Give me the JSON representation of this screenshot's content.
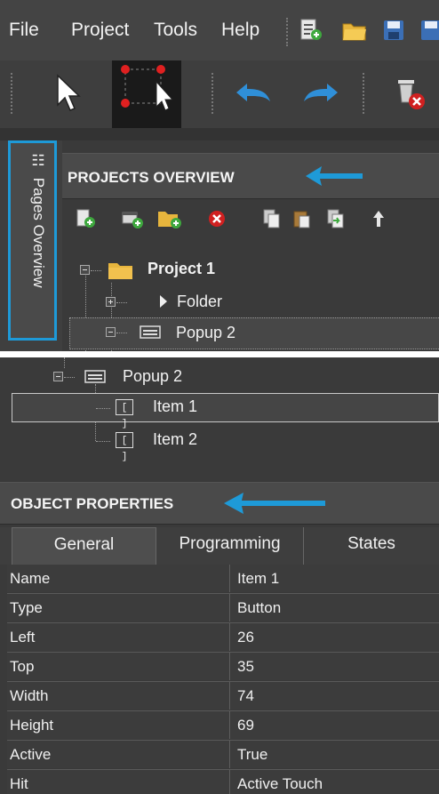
{
  "menu": {
    "file": "File",
    "project": "Project",
    "tools": "Tools",
    "help": "Help"
  },
  "toolbar_icons": [
    "new-document-icon",
    "open-folder-icon",
    "save-icon",
    "save-all-icon",
    "select-arrow-icon",
    "multi-select-icon",
    "undo-icon",
    "redo-icon",
    "delete-icon"
  ],
  "pages_tab": {
    "label": "Pages Overview"
  },
  "projects_overview": {
    "title": "PROJECTS OVERVIEW",
    "tree": {
      "project": "Project 1",
      "folder": "Folder",
      "popup": "Popup 2"
    }
  },
  "tree_bottom": {
    "popup": "Popup 2",
    "items": [
      "Item 1",
      "Item 2"
    ]
  },
  "object_properties": {
    "title": "OBJECT PROPERTIES",
    "tabs": [
      "General",
      "Programming",
      "States"
    ],
    "active_tab": "General",
    "rows": [
      {
        "name": "Name",
        "value": "Item 1"
      },
      {
        "name": "Type",
        "value": "Button"
      },
      {
        "name": "Left",
        "value": "26"
      },
      {
        "name": "Top",
        "value": "35"
      },
      {
        "name": "Width",
        "value": "74"
      },
      {
        "name": "Height",
        "value": "69"
      },
      {
        "name": "Active",
        "value": "True"
      },
      {
        "name": "Hit",
        "value": "Active Touch"
      }
    ]
  },
  "colors": {
    "highlight_arrow": "#1e9ad8",
    "panel": "#3a3a3a"
  }
}
